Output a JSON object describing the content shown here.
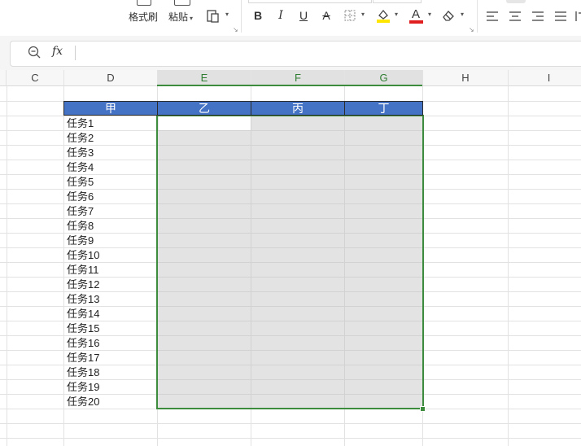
{
  "ribbon": {
    "format_painter_label": "格式刷",
    "paste_label": "粘贴",
    "bold_label": "B",
    "italic_label": "I",
    "underline_label": "U",
    "strikethrough_label": "A",
    "font_color_label": "A",
    "icons": [
      "format-painter-icon",
      "paste-icon",
      "paste-special-icon",
      "border-icon",
      "fill-color-icon",
      "font-color-icon",
      "clear-icon",
      "align-left-icon",
      "align-center-icon",
      "align-right-icon",
      "justify-icon"
    ]
  },
  "formula_bar": {
    "fx_label": "fx",
    "value": ""
  },
  "columns": [
    "C",
    "D",
    "E",
    "F",
    "G",
    "H",
    "I"
  ],
  "table": {
    "headers": [
      "甲",
      "乙",
      "丙",
      "丁"
    ],
    "tasks": [
      "任务1",
      "任务2",
      "任务3",
      "任务4",
      "任务5",
      "任务6",
      "任务7",
      "任务8",
      "任务9",
      "任务10",
      "任务11",
      "任务12",
      "任务13",
      "任务14",
      "任务15",
      "任务16",
      "任务17",
      "任务18",
      "任务19",
      "任务20"
    ]
  },
  "colors": {
    "header_fill": "#4472c4",
    "selection_border": "#3d8b3d",
    "selection_fill": "#e3e3e3",
    "fill_color_swatch": "#ffe600",
    "font_color_swatch": "#e02020"
  }
}
